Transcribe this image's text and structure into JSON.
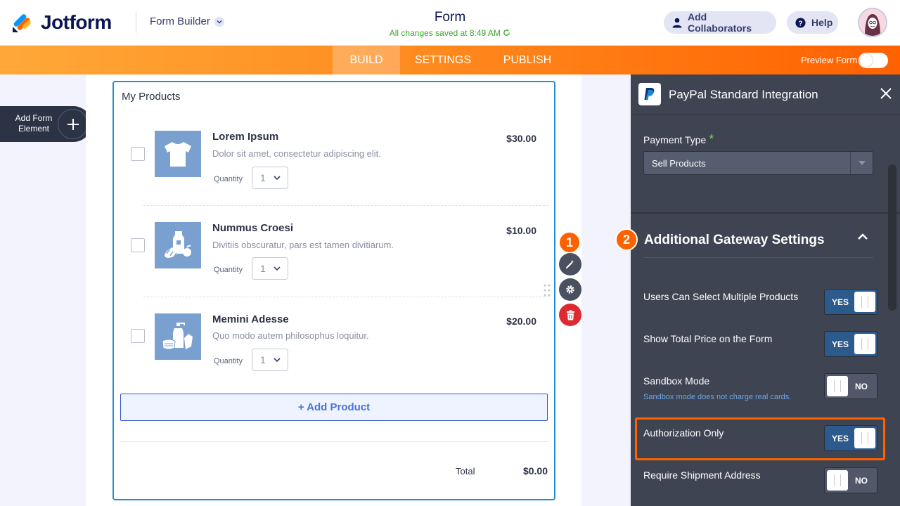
{
  "header": {
    "logo_text": "Jotform",
    "builder_label": "Form Builder",
    "form_title": "Form",
    "saved_status": "All changes saved at 8:49 AM",
    "collaborators_label": "Add Collaborators",
    "help_label": "Help"
  },
  "nav": {
    "tabs": [
      {
        "label": "BUILD",
        "active": true
      },
      {
        "label": "SETTINGS",
        "active": false
      },
      {
        "label": "PUBLISH",
        "active": false
      }
    ],
    "preview_label": "Preview Form",
    "preview_on": false
  },
  "left": {
    "add_element_label": "Add Form Element"
  },
  "form": {
    "field_label": "My Products",
    "products": [
      {
        "name": "Lorem Ipsum",
        "description": "Dolor sit amet, consectetur adipiscing elit.",
        "price": "$30.00",
        "quantity_label": "Quantity",
        "quantity": "1",
        "icon": "tshirt-icon"
      },
      {
        "name": "Nummus Croesi",
        "description": "Divitiis obscuratur, pars est tamen divitiarum.",
        "price": "$10.00",
        "quantity_label": "Quantity",
        "quantity": "1",
        "icon": "groceries-icon"
      },
      {
        "name": "Memini Adesse",
        "description": "Quo modo autem philosophus loquitur.",
        "price": "$20.00",
        "quantity_label": "Quantity",
        "quantity": "1",
        "icon": "hygiene-products-icon"
      }
    ],
    "add_product_label": "+ Add Product",
    "total_label": "Total",
    "total_value": "$0.00"
  },
  "badges": {
    "step1": "1",
    "step2": "2"
  },
  "panel": {
    "title": "PayPal Standard Integration",
    "payment_type_label": "Payment Type",
    "payment_type_value": "Sell Products",
    "section_title": "Additional Gateway Settings",
    "settings": [
      {
        "label": "Users Can Select Multiple Products",
        "value": "YES",
        "on": true
      },
      {
        "label": "Show Total Price on the Form",
        "value": "YES",
        "on": true
      },
      {
        "label": "Sandbox Mode",
        "sub": "Sandbox mode does not charge real cards.",
        "value": "NO",
        "on": false
      },
      {
        "label": "Authorization Only",
        "value": "YES",
        "on": true
      },
      {
        "label": "Require Shipment Address",
        "value": "NO",
        "on": false
      }
    ]
  },
  "colors": {
    "accent_orange": "#ff6100",
    "brand_blue": "#0a1551",
    "field_border": "#1f8ed3",
    "panel_bg": "#3e4451",
    "saved_green": "#3da52c"
  }
}
